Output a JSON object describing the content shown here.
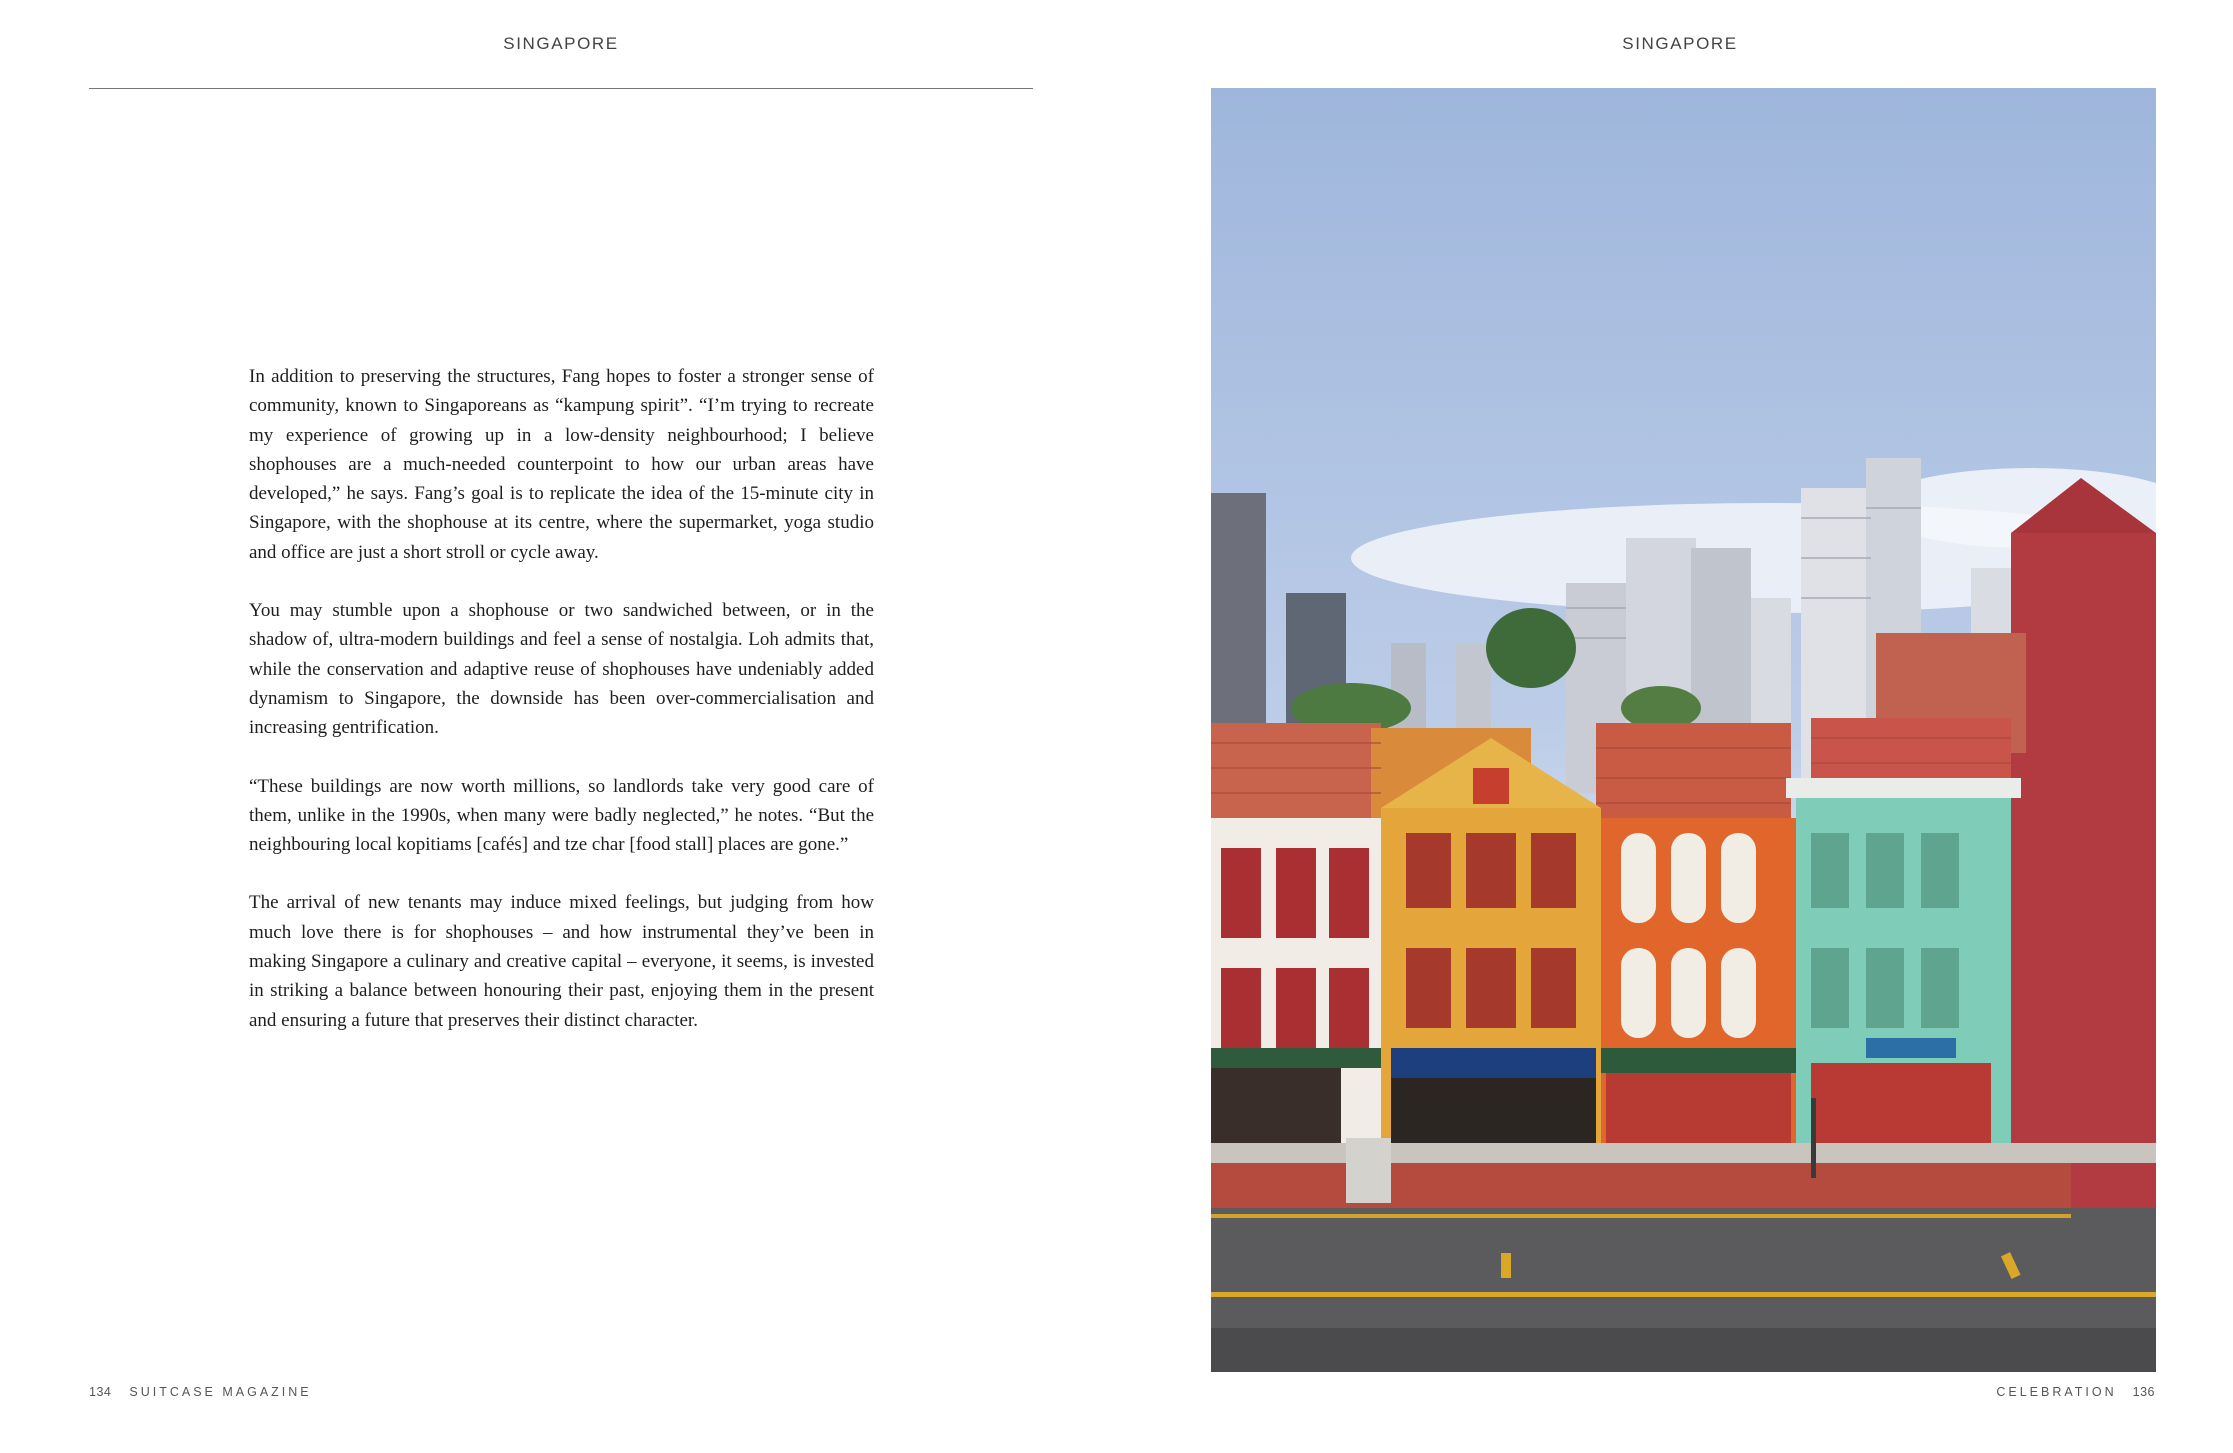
{
  "left_page": {
    "running_head": "SINGAPORE",
    "paragraphs": [
      "In addition to preserving the structures, Fang hopes to foster a stronger sense of community, known to Singaporeans as “kampung spirit”. “I’m trying to recreate my experience of growing up in a low-density neighbourhood; I believe shophouses are a much-needed counterpoint to how our urban areas have developed,” he says. Fang’s goal is to replicate the idea of the 15-minute city in Singapore, with the shophouse at its centre, where the supermarket, yoga studio and office are just a short stroll or cycle away.",
      "You may stumble upon a shophouse or two sandwiched between, or in the shadow of, ultra-modern buildings and feel a sense of nostalgia. Loh admits that, while the conservation and adaptive reuse of shophouses have undeniably added dynamism to Singapore, the downside has been over-commercialisation and increasing gentrification.",
      "“These buildings are now worth millions, so landlords take very good care of them, unlike in the 1990s, when many were badly neglected,” he notes. “But the neighbouring local kopitiams [cafés] and tze char [food stall] places are gone.”",
      "The arrival of new tenants may induce mixed feelings, but judging from how much love there is for shophouses – and how instrumental they’ve been in making Singapore a culinary and creative capital – everyone, it seems, is invested in striking a balance between honouring their past, enjoying them in the present and ensuring a future that preserves their distinct character."
    ],
    "folio_number": "134",
    "folio_title": "SUITCASE MAGAZINE"
  },
  "right_page": {
    "running_head": "SINGAPORE",
    "photo_subject": "Row of colourful Peranakan shophouses along a street, with high-rise towers behind",
    "folio_section": "CELEBRATION",
    "folio_number": "136"
  },
  "colors": {
    "sky": "#a9bfe0",
    "yellow_shophouse": "#e3a83a",
    "orange_shophouse": "#e0662c",
    "mint_shophouse": "#7fcdb8",
    "red_shophouse": "#b43a3e",
    "road": "#5b5b5e"
  }
}
